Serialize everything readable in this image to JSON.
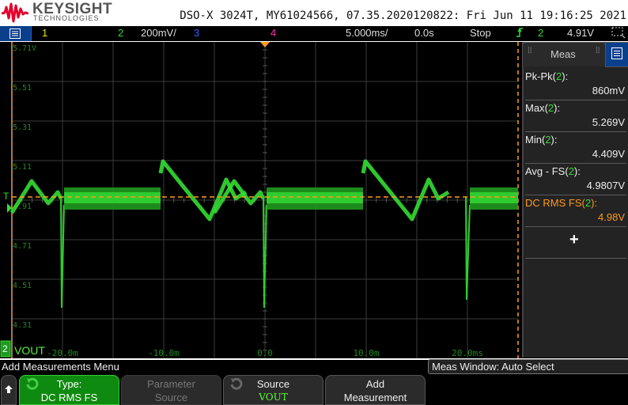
{
  "header": {
    "brand": "KEYSIGHT",
    "brand_sub": "TECHNOLOGIES",
    "model_info": "DSO-X 3024T, MY61024566, 07.35.2020120822: Fri Jun 11 19:16:25 2021"
  },
  "status_bar": {
    "ch1_label": "1",
    "ch2_label": "2",
    "ch2_scale": "200mV/",
    "ch3_label": "3",
    "ch4_label": "4",
    "timebase": "5.000ms/",
    "delay": "0.0s",
    "run_state": "Stop",
    "trigger_source": "2",
    "trigger_level": "4.91V"
  },
  "plot": {
    "channel_badge": "2",
    "channel_name": "VOUT",
    "volt_labels": [
      "5.71V",
      "5.51",
      "5.31",
      "5.11",
      "4.91",
      "4.71",
      "4.51",
      "4.31"
    ],
    "time_labels": [
      "-20.0m",
      "-10.0m",
      "0.0",
      "10.0m",
      "20.0ms"
    ],
    "trigger_marker": "T",
    "colors": {
      "ch1": "#e8e800",
      "ch2": "#33dd33",
      "ch3": "#3a5cff",
      "ch4": "#ff2ab0",
      "marker": "#ff9a1a"
    }
  },
  "measurements": {
    "tab_label": "Meas",
    "items": [
      {
        "name": "Pk-Pk",
        "channel": "2",
        "value": "860mV",
        "selected": false
      },
      {
        "name": "Max",
        "channel": "2",
        "value": "5.269V",
        "selected": false
      },
      {
        "name": "Min",
        "channel": "2",
        "value": "4.409V",
        "selected": false
      },
      {
        "name": "Avg - FS",
        "channel": "2",
        "value": "4.9807V",
        "selected": false
      },
      {
        "name": "DC RMS FS",
        "channel": "2",
        "value": "4.98V",
        "selected": true
      }
    ],
    "add_icon": "+"
  },
  "softkeys": {
    "menu_title": "Add Measurements Menu",
    "meas_window": "Meas Window: Auto Select",
    "type_l1": "Type:",
    "type_l2": "DC RMS FS",
    "param_l1": "Parameter",
    "param_l2": "Source",
    "source_l1": "Source",
    "source_l2": "VOUT",
    "add_l1": "Add",
    "add_l2": "Measurement"
  }
}
